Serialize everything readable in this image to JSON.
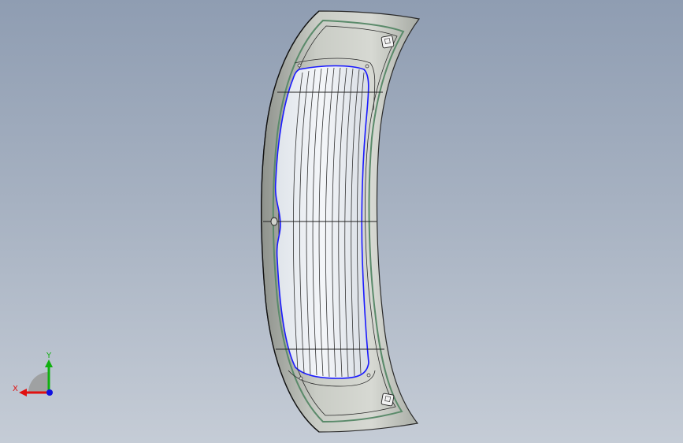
{
  "viewport": {
    "background_top": "#8f9db2",
    "background_bottom": "#c5ccd6"
  },
  "model": {
    "part_name": "curved-panel-with-window",
    "body_color": "#b9bdb5",
    "glass_color": "#e8edf3",
    "edge_color": "#2a2a2a",
    "seal_color": "#5a8a6a",
    "selection_color": "#1a1aff"
  },
  "triad": {
    "x_label": "X",
    "y_label": "Y",
    "x_color": "#e01010",
    "y_color": "#10b010",
    "z_color": "#1010e0"
  }
}
